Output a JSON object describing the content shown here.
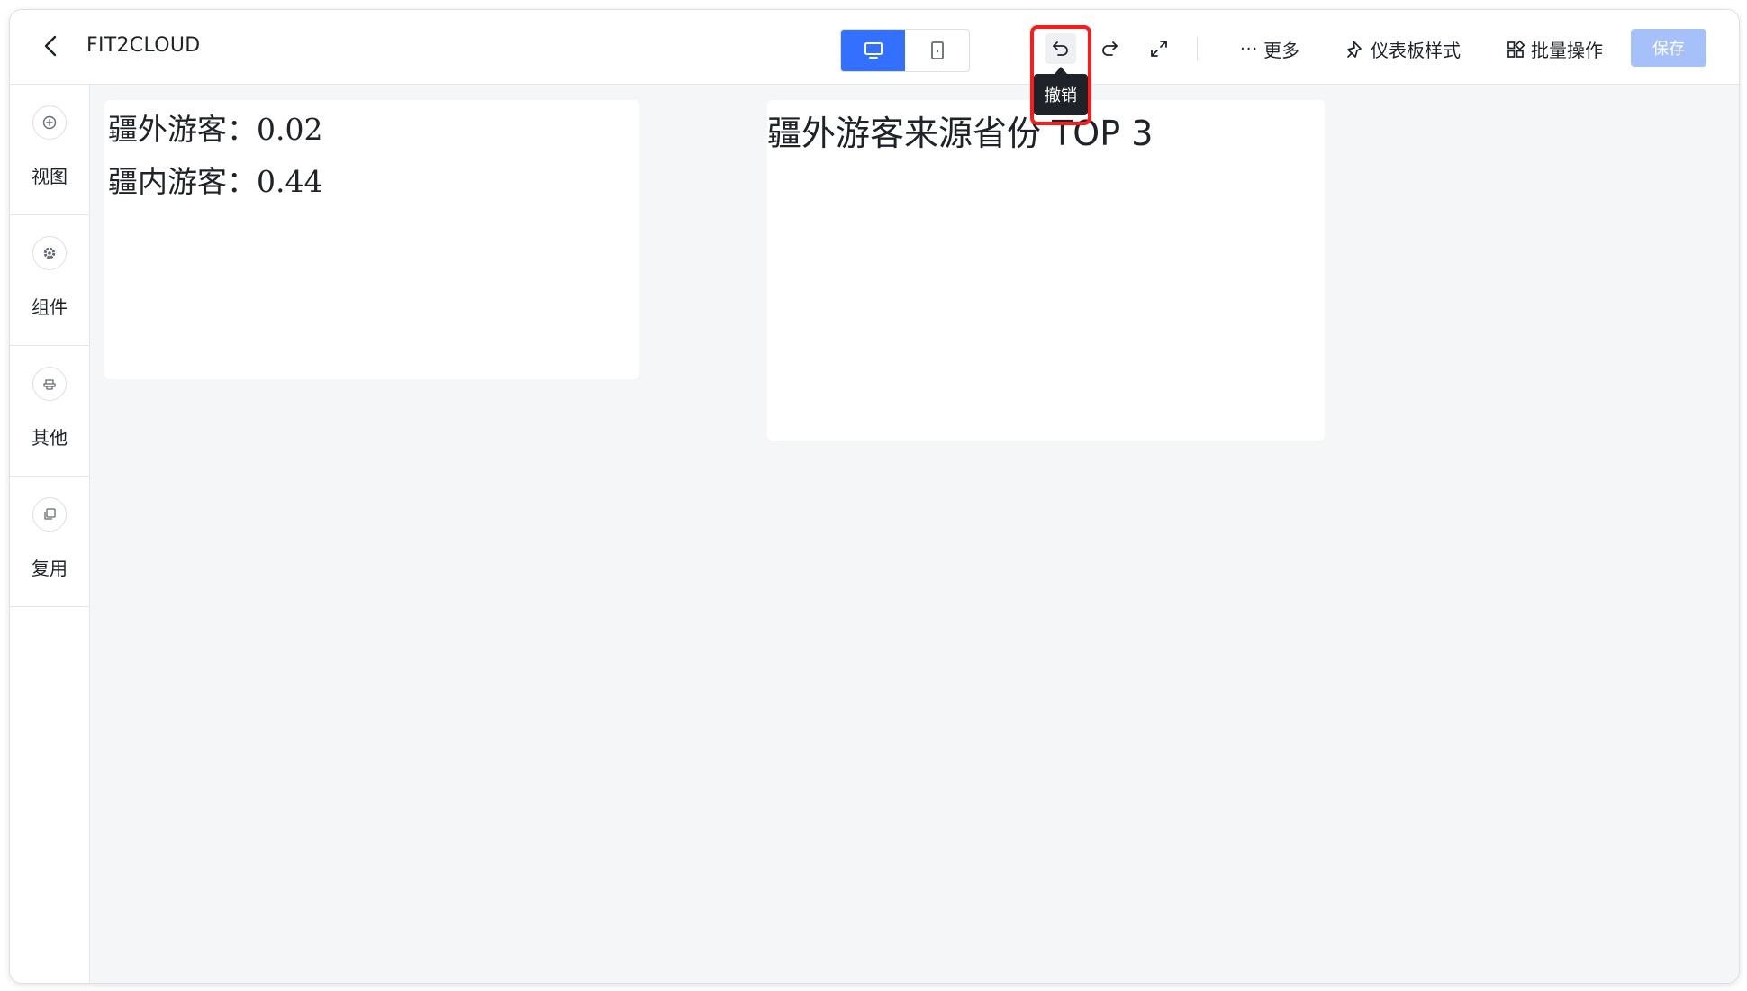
{
  "header": {
    "app_title": "FIT2CLOUD",
    "undo_tooltip": "撤销",
    "more_label": "更多",
    "dashboard_style_label": "仪表板样式",
    "batch_label": "批量操作",
    "save_label": "保存"
  },
  "sidebar": {
    "items": [
      {
        "label": "视图",
        "icon": "plus-circle-icon"
      },
      {
        "label": "组件",
        "icon": "gear-icon"
      },
      {
        "label": "其他",
        "icon": "stamp-icon"
      },
      {
        "label": "复用",
        "icon": "copy-icon"
      }
    ]
  },
  "canvas": {
    "card1": {
      "line1": "疆外游客：0.02",
      "line2": "疆内游客：0.44"
    },
    "card2": {
      "title": "疆外游客来源省份 TOP 3"
    }
  },
  "colors": {
    "accent": "#3370ff",
    "save_disabled": "#a6c1f9",
    "highlight": "#ff1a1a",
    "tooltip_bg": "#1f2329"
  }
}
